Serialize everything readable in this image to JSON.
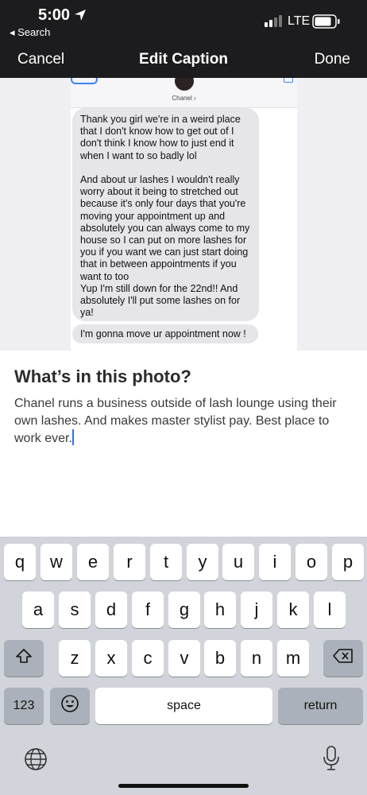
{
  "status_bar": {
    "time": "5:00",
    "back_label": "◂ Search",
    "network": "LTE"
  },
  "nav": {
    "cancel": "Cancel",
    "title": "Edit Caption",
    "done": "Done"
  },
  "photo": {
    "contact_name": "Chanel ›",
    "message_1": "Thank you girl we're in a weird place that I don't know how to get out of I don't think I know how to just end it when I want to so badly lol\n\nAnd about ur lashes I wouldn't really worry about it being to stretched out because it's only four days that you're moving your appointment up and absolutely you can always come to my house so I can put on more lashes for you if you want we can just start doing that in between appointments if you want to too\nYup I'm still down for the 22nd!! And absolutely I'll put some lashes on for ya!",
    "message_2": "I'm gonna move ur appointment now !"
  },
  "caption": {
    "heading": "What’s in this photo?",
    "text": "Chanel runs a business outside of lash lounge using their own lashes. And makes master stylist pay. Best place to work ever."
  },
  "keyboard": {
    "row1": [
      "q",
      "w",
      "e",
      "r",
      "t",
      "y",
      "u",
      "i",
      "o",
      "p"
    ],
    "row2": [
      "a",
      "s",
      "d",
      "f",
      "g",
      "h",
      "j",
      "k",
      "l"
    ],
    "row3": [
      "z",
      "x",
      "c",
      "v",
      "b",
      "n",
      "m"
    ],
    "numbers": "123",
    "space": "space",
    "return": "return",
    "icons": [
      "shift-icon",
      "delete-icon",
      "emoji-icon",
      "globe-icon",
      "microphone-icon"
    ]
  },
  "colors": {
    "nav_bg": "#1c1c1e",
    "cursor": "#2f6df6",
    "keyboard_bg": "#d1d4da",
    "bubble": "#e5e5ea"
  }
}
